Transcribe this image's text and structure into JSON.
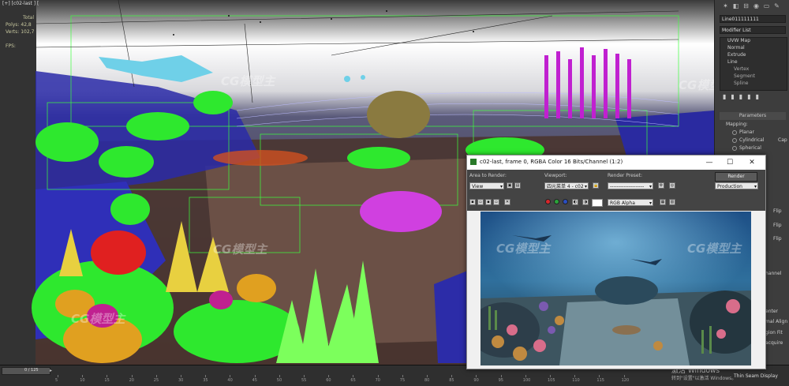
{
  "viewport": {
    "label": "[+] [c02-last ] [",
    "stats": [
      {
        "label": "Total",
        "value": ""
      },
      {
        "label": "Polys:",
        "value": "42,8"
      },
      {
        "label": "Verts:",
        "value": "102,7"
      }
    ],
    "fps_label": "FPS:"
  },
  "command_panel": {
    "object_name": "Line011111111",
    "modifier_list_label": "Modifier List",
    "modifier_stack": [
      {
        "name": "UVW Map",
        "level": 0
      },
      {
        "name": "Normal",
        "level": 0
      },
      {
        "name": "Extrude",
        "level": 0
      },
      {
        "name": "Line",
        "level": 0
      },
      {
        "name": "Vertex",
        "level": 1
      },
      {
        "name": "Segment",
        "level": 1
      },
      {
        "name": "Spline",
        "level": 1
      }
    ],
    "parameters_label": "Parameters",
    "mapping_label": "Mapping:",
    "mapping_options": [
      "Planar",
      "Cylindrical",
      "Spherical"
    ],
    "cap_label": "Cap",
    "flip_labels": [
      "Flip",
      "Flip",
      "Flip"
    ],
    "partial_labels": [
      "hannel",
      "enter",
      "mal Align",
      "gion Fit",
      "acquire"
    ]
  },
  "render_window": {
    "title": "c02-last, frame 0, RGBA Color 16 Bits/Channel (1:2)",
    "controls": {
      "minimize": "—",
      "maximize": "☐",
      "close": "✕"
    },
    "area_to_render_label": "Area to Render:",
    "area_to_render_value": "View",
    "viewport_label": "Viewport:",
    "viewport_value": "四元菜单 4 - c02",
    "render_preset_label": "Render Preset:",
    "render_preset_value": "--------------------",
    "render_button": "Render",
    "render_mode_value": "Production",
    "channel_value": "RGB Alpha",
    "channel_colors": {
      "red": "#d8262b",
      "green": "#2aa43a",
      "blue": "#2a4ec2"
    }
  },
  "timeline": {
    "frame_indicator": "0 / 125",
    "ticks": [
      "5",
      "10",
      "15",
      "20",
      "25",
      "30",
      "35",
      "40",
      "45",
      "50",
      "55",
      "60",
      "65",
      "70",
      "75",
      "80",
      "85",
      "90",
      "95",
      "100",
      "105",
      "110",
      "115",
      "120"
    ]
  },
  "watermark": {
    "text": "CG模型主",
    "activate_windows": "激活 Windows",
    "activate_sub": "转到\"设置\"以激活 Windows。",
    "status_right": "Thin Seam Display"
  }
}
